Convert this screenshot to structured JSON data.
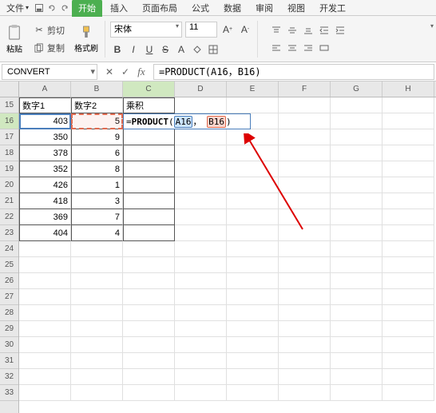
{
  "tabs": {
    "file": "文件",
    "start": "开始",
    "insert": "插入",
    "layout": "页面布局",
    "formula": "公式",
    "data": "数据",
    "review": "审阅",
    "view": "视图",
    "dev": "开发工",
    "more": "..."
  },
  "clipboard": {
    "paste": "粘贴",
    "cut": "剪切",
    "copy": "复制",
    "painter": "格式刷"
  },
  "font": {
    "name": "宋体",
    "size": "11",
    "bold": "B",
    "italic": "I",
    "underline": "U"
  },
  "namebox": "CONVERT",
  "formula": {
    "full": "=PRODUCT(A16，B16)",
    "prefix": "=",
    "fn": "PRODUCT",
    "open": "(",
    "ref1": "A16",
    "comma": "，",
    "ref2": "B16",
    "close": ")"
  },
  "columns": [
    "A",
    "B",
    "C",
    "D",
    "E",
    "F",
    "G",
    "H"
  ],
  "row_labels": [
    15,
    16,
    17,
    18,
    19,
    20,
    21,
    22,
    23,
    24,
    25,
    26,
    27,
    28,
    29,
    30,
    31,
    32,
    33
  ],
  "headers": {
    "c1": "数字1",
    "c2": "数字2",
    "c3": "乘积"
  },
  "table": [
    {
      "a": 403,
      "b": 5
    },
    {
      "a": 350,
      "b": 9
    },
    {
      "a": 378,
      "b": 6
    },
    {
      "a": 352,
      "b": 8
    },
    {
      "a": 426,
      "b": 1
    },
    {
      "a": 418,
      "b": 3
    },
    {
      "a": 369,
      "b": 7
    },
    {
      "a": 404,
      "b": 4
    }
  ]
}
